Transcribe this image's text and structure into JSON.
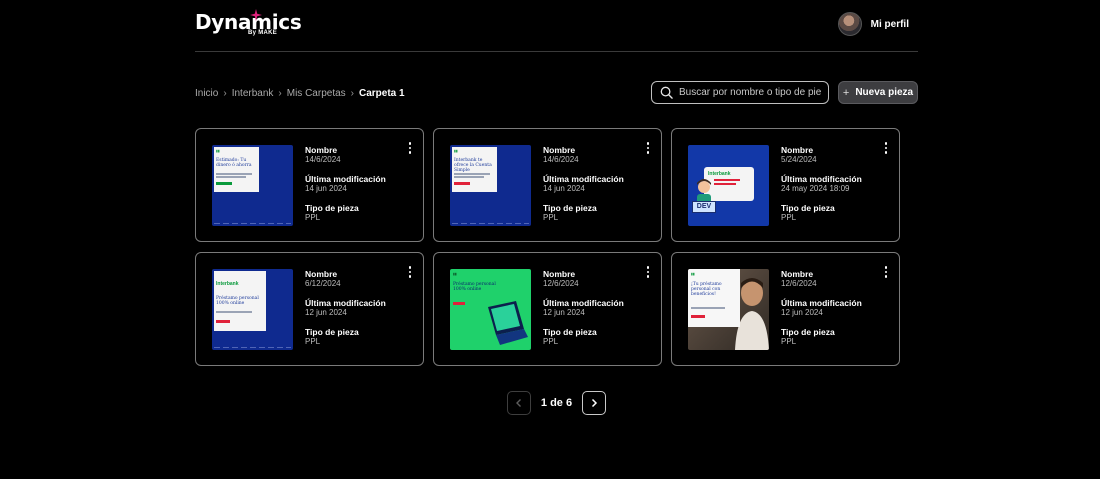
{
  "brand": {
    "name": "Dynamics",
    "sub": "By MAKE",
    "accent": "#e0217b"
  },
  "profile": {
    "label": "Mi perfil"
  },
  "breadcrumb": [
    {
      "label": "Inicio"
    },
    {
      "label": "Interbank"
    },
    {
      "label": "Mis Carpetas"
    },
    {
      "label": "Carpeta 1"
    }
  ],
  "search": {
    "placeholder": "Buscar por nombre o tipo de pie",
    "value": ""
  },
  "new_button": {
    "label": "Nueva pieza",
    "icon": "plus-icon"
  },
  "labels": {
    "name": "Nombre",
    "modified": "Última modificación",
    "type": "Tipo de pieza"
  },
  "cards": [
    {
      "date": "14/6/2024",
      "modified": "14 jun 2024",
      "type": "PPL",
      "thumb_style": "blue",
      "thumb_title": "Estimado: Tu dinero ó ahorra"
    },
    {
      "date": "14/6/2024",
      "modified": "14 jun 2024",
      "type": "PPL",
      "thumb_style": "blue",
      "thumb_title": "Interbank te ofrece la Cuenta Simple"
    },
    {
      "date": "5/24/2024",
      "modified": "24 may 2024 18:09",
      "type": "PPL",
      "thumb_style": "dev",
      "thumb_title": "Interbank",
      "thumb_badge": "DEV"
    },
    {
      "date": "6/12/2024",
      "modified": "12 jun 2024",
      "type": "PPL",
      "thumb_style": "blue",
      "thumb_title": "Préstamo personal 100% online",
      "thumb_brand": "Interbank"
    },
    {
      "date": "12/6/2024",
      "modified": "12 jun 2024",
      "type": "PPL",
      "thumb_style": "green",
      "thumb_title": "Préstamo personal 100% online"
    },
    {
      "date": "12/6/2024",
      "modified": "12 jun 2024",
      "type": "PPL",
      "thumb_style": "photo",
      "thumb_title": "¡Tu préstamo personal con beneficios!"
    }
  ],
  "pagination": {
    "text": "1 de 6",
    "current": 1,
    "total": 6
  },
  "colors": {
    "background": "#000000",
    "card_border": "#7a7a7a",
    "thumb_blue": "#0f2a8f",
    "thumb_green": "#1fd16b"
  }
}
